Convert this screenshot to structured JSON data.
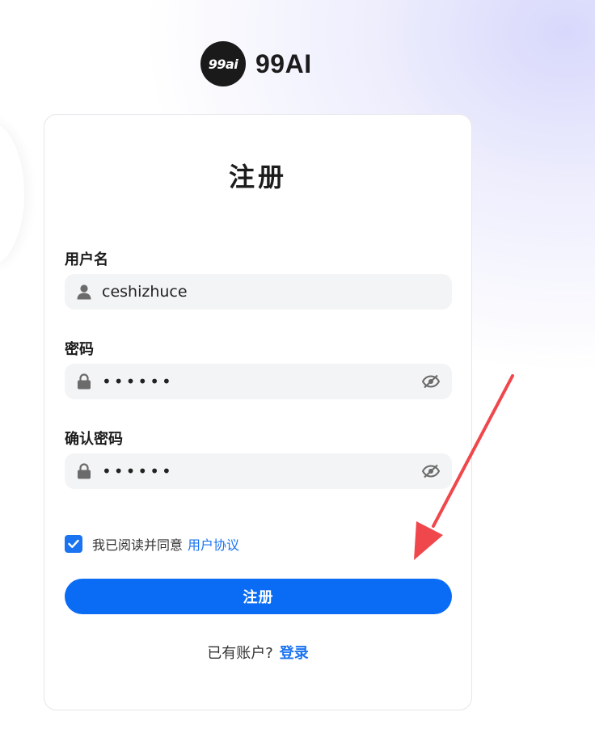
{
  "brand": {
    "logo_text": "99ai",
    "name": "99AI"
  },
  "form": {
    "title": "注册",
    "username": {
      "label": "用户名",
      "value": "ceshizhuce"
    },
    "password": {
      "label": "密码",
      "value": "••••••"
    },
    "confirm_password": {
      "label": "确认密码",
      "value": "••••••"
    },
    "agreement": {
      "checked": true,
      "text": "我已阅读并同意",
      "link": "用户协议"
    },
    "submit_label": "注册",
    "login_prompt": "已有账户?",
    "login_link": "登录"
  },
  "colors": {
    "accent": "#0a6cf5",
    "link": "#1a73f0",
    "annotation_arrow": "#f0474c",
    "field_bg": "#f3f4f5"
  },
  "icons": {
    "username": "user-icon",
    "password": "lock-icon",
    "toggle": "eye-off-icon",
    "checkbox": "check-icon"
  }
}
